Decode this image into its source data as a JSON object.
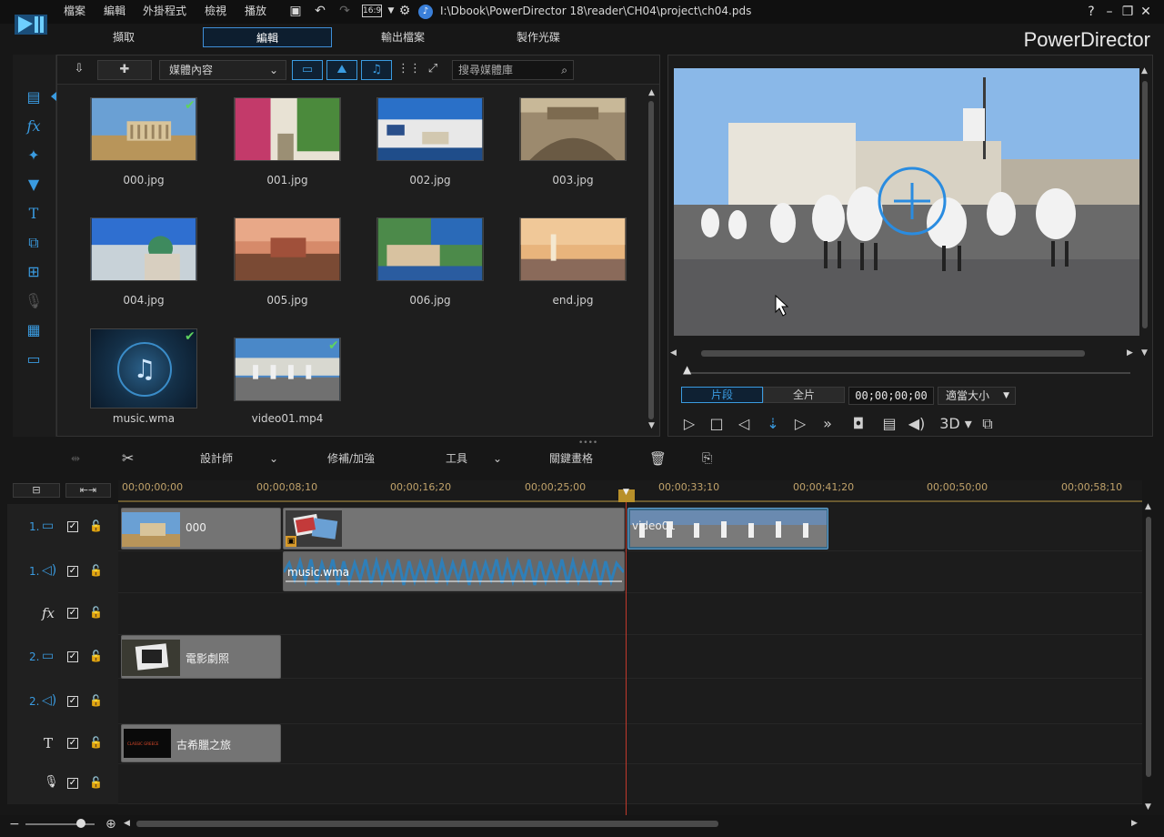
{
  "app": {
    "brand": "PowerDirector",
    "path": "I:\\Dbook\\PowerDirector 18\\reader\\CH04\\project\\ch04.pds",
    "aspect": "16:9"
  },
  "menu": [
    "檔案",
    "編輯",
    "外掛程式",
    "檢視",
    "播放"
  ],
  "modes": {
    "capture": "擷取",
    "edit": "編輯",
    "produce": "輸出檔案",
    "disc": "製作光碟"
  },
  "library": {
    "dropdown": "媒體內容",
    "search_placeholder": "搜尋媒體庫",
    "items": [
      {
        "name": "000.jpg",
        "checked": true
      },
      {
        "name": "001.jpg",
        "checked": false
      },
      {
        "name": "002.jpg",
        "checked": false
      },
      {
        "name": "003.jpg",
        "checked": false
      },
      {
        "name": "004.jpg",
        "checked": false
      },
      {
        "name": "005.jpg",
        "checked": false
      },
      {
        "name": "006.jpg",
        "checked": false
      },
      {
        "name": "end.jpg",
        "checked": false
      },
      {
        "name": "music.wma",
        "checked": true
      },
      {
        "name": "video01.mp4",
        "checked": true
      }
    ]
  },
  "preview": {
    "clip_tab": "片段",
    "movie_tab": "全片",
    "timecode": "00;00;00;00",
    "fit": "適當大小",
    "mode3d": "3D"
  },
  "timeline_toolbar": {
    "designer": "設計師",
    "fix": "修補/加強",
    "tools": "工具",
    "keyframe": "關鍵畫格"
  },
  "ruler": [
    "00;00;00;00",
    "00;00;08;10",
    "00;00;16;20",
    "00;00;25;00",
    "00;00;33;10",
    "00;00;41;20",
    "00;00;50;00",
    "00;00;58;10"
  ],
  "tracks": {
    "t1_num": "1.",
    "t2_num": "2.",
    "clip_000": "000",
    "clip_video": "video01",
    "clip_music": "music.wma",
    "clip_film": "電影劇照",
    "clip_title": "古希臘之旅",
    "title_thumb_text": "CLASSIC GREECE"
  },
  "colors": {
    "accent": "#3a9be0",
    "ruler": "#c0a26a",
    "playhead": "#c0392b"
  }
}
